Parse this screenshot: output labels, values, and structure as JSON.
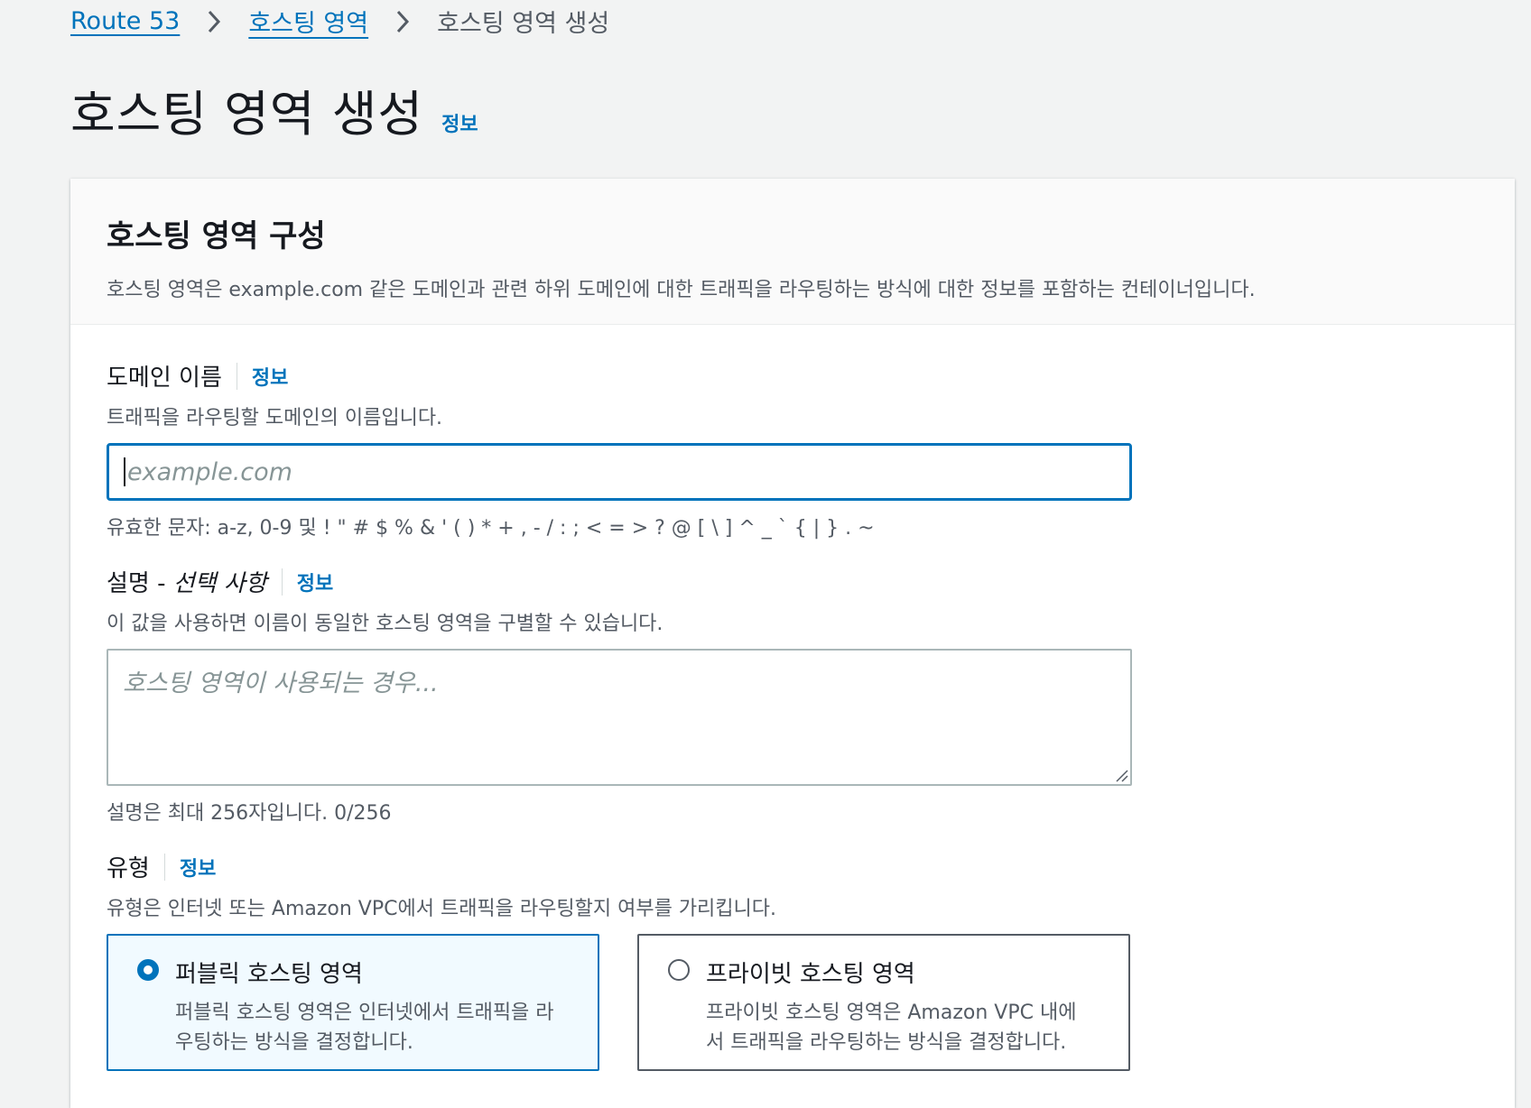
{
  "breadcrumb": {
    "items": [
      "Route 53",
      "호스팅 영역"
    ],
    "current": "호스팅 영역 생성"
  },
  "page": {
    "title": "호스팅 영역 생성",
    "info_label": "정보"
  },
  "panel": {
    "title": "호스팅 영역 구성",
    "description": "호스팅 영역은 example.com 같은 도메인과 관련 하위 도메인에 대한 트래픽을 라우팅하는 방식에 대한 정보를 포함하는 컨테이너입니다."
  },
  "domain_field": {
    "label": "도메인 이름",
    "info_label": "정보",
    "description": "트래픽을 라우팅할 도메인의 이름입니다.",
    "value": "",
    "placeholder": "example.com",
    "constraint": "유효한 문자: a-z, 0-9 및 ! \" # $ % & ' ( ) * + , - / : ; < = > ? @ [ \\ ] ^ _ ` { | } . ~"
  },
  "description_field": {
    "label": "설명 - ",
    "label_optional": "선택 사항",
    "info_label": "정보",
    "description": "이 값을 사용하면 이름이 동일한 호스팅 영역을 구별할 수 있습니다.",
    "value": "",
    "placeholder": "호스팅 영역이 사용되는 경우...",
    "constraint": "설명은 최대 256자입니다. 0/256"
  },
  "type_field": {
    "label": "유형",
    "info_label": "정보",
    "description": "유형은 인터넷 또는 Amazon VPC에서 트래픽을 라우팅할지 여부를 가리킵니다.",
    "options": [
      {
        "title": "퍼블릭 호스팅 영역",
        "desc_line1": "퍼블릭 호스팅 영역은 인터넷에서 트래픽을 라",
        "desc_line2": "우팅하는 방식을 결정합니다.",
        "selected": true
      },
      {
        "title": "프라이빗 호스팅 영역",
        "desc_line1": "프라이빗 호스팅 영역은 Amazon VPC 내에",
        "desc_line2": "서 트래픽을 라우팅하는 방식을 결정합니다.",
        "selected": false
      }
    ]
  },
  "colors": {
    "accent": "#0073bb",
    "background": "#f2f3f3",
    "text": "#16191f",
    "muted": "#545b64"
  }
}
